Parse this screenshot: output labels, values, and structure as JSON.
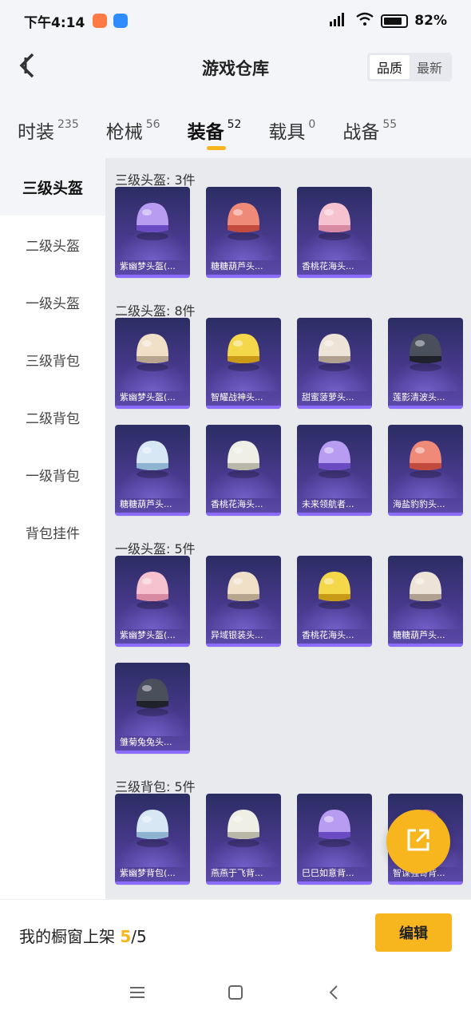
{
  "status_bar": {
    "time": "下午4:14",
    "battery": "82%"
  },
  "header": {
    "title": "游戏仓库",
    "sort_options": [
      "品质",
      "最新"
    ]
  },
  "tabs": [
    {
      "label": "时装",
      "count": "235"
    },
    {
      "label": "枪械",
      "count": "56"
    },
    {
      "label": "装备",
      "count": "52"
    },
    {
      "label": "载具",
      "count": "0"
    },
    {
      "label": "战备",
      "count": "55"
    }
  ],
  "sidebar": {
    "items": [
      "三级头盔",
      "二级头盔",
      "一级头盔",
      "三级背包",
      "二级背包",
      "一级背包",
      "背包挂件"
    ]
  },
  "sections": [
    {
      "title": "三级头盔: 3件",
      "items": [
        "紫幽梦头盔(...",
        "糖糖葫芦头...",
        "香桃花海头..."
      ]
    },
    {
      "title": "二级头盔: 8件",
      "items": [
        "紫幽梦头盔(...",
        "智耀战神头...",
        "甜蜜菠萝头...",
        "莲影清波头...",
        "糖糖葫芦头...",
        "香桃花海头...",
        "未来领航者...",
        "海盐豹豹头..."
      ]
    },
    {
      "title": "一级头盔: 5件",
      "items": [
        "紫幽梦头盔(...",
        "异域银装头...",
        "香桃花海头...",
        "糖糖葫芦头...",
        "雏菊兔兔头..."
      ]
    },
    {
      "title": "三级背包: 5件",
      "items": [
        "紫幽梦背包(...",
        "燕燕于飞背...",
        "巳巳如意背...",
        "智谋强哥背..."
      ]
    }
  ],
  "bottom": {
    "showcase_label": "我的橱窗上架",
    "showcase_current": "5",
    "showcase_total": "/5",
    "edit_label": "编辑"
  },
  "colors": {
    "accent": "#f7b51e",
    "card_top": "#2b2d63",
    "card_bottom": "#5b4aa8"
  },
  "icons": {
    "back": "chevron-left-icon",
    "share": "share-icon",
    "nav": [
      "menu-icon",
      "home-icon",
      "back-icon"
    ]
  }
}
